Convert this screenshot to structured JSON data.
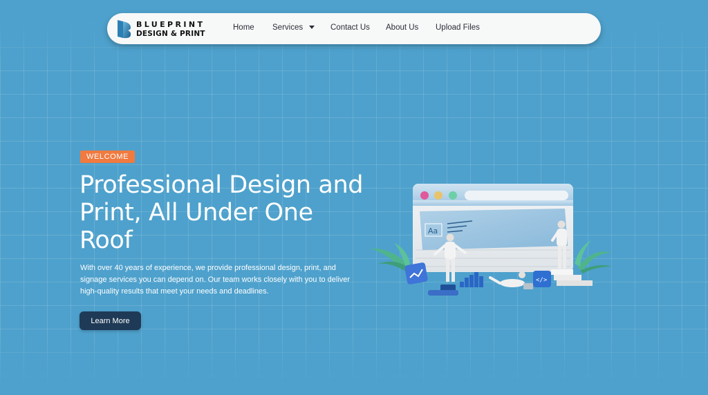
{
  "brand": {
    "line1": "BLUEPRINT",
    "line2": "DESIGN & PRINT"
  },
  "nav": {
    "home": "Home",
    "services": "Services",
    "contact": "Contact Us",
    "about": "About Us",
    "upload": "Upload Files"
  },
  "hero": {
    "badge": "WELCOME",
    "headline": "Professional Design and Print, All Under One Roof",
    "description": "With over 40 years of experience, we provide professional design, print, and signage services you can depend on. Our team works closely with you to deliver high-quality results that meet your needs and deadlines.",
    "cta": "Learn More",
    "illustration": {
      "text_sample": "Aa",
      "code_sample": "</>"
    }
  },
  "colors": {
    "background": "#4ea1cc",
    "badge": "#f07a3f",
    "cta": "#1e3a56",
    "navbar": "#f7f8f8"
  }
}
